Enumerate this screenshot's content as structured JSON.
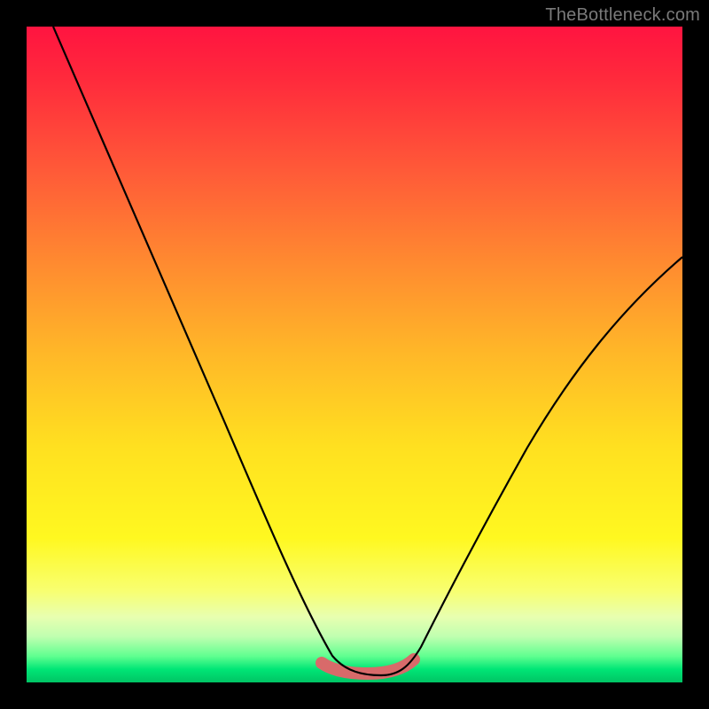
{
  "watermark": {
    "text": "TheBottleneck.com"
  },
  "chart_data": {
    "type": "line",
    "title": "",
    "xlabel": "",
    "ylabel": "",
    "xlim": [
      0,
      100
    ],
    "ylim": [
      0,
      100
    ],
    "grid": false,
    "legend": false,
    "gradient_stops": [
      {
        "pct": 0,
        "color": "#ff1440"
      },
      {
        "pct": 8,
        "color": "#ff2a3c"
      },
      {
        "pct": 22,
        "color": "#ff5a38"
      },
      {
        "pct": 36,
        "color": "#ff8a30"
      },
      {
        "pct": 50,
        "color": "#ffb828"
      },
      {
        "pct": 64,
        "color": "#ffe020"
      },
      {
        "pct": 78,
        "color": "#fff820"
      },
      {
        "pct": 86,
        "color": "#f8ff70"
      },
      {
        "pct": 90,
        "color": "#e8ffb0"
      },
      {
        "pct": 93,
        "color": "#c0ffb0"
      },
      {
        "pct": 96,
        "color": "#60ff90"
      },
      {
        "pct": 98,
        "color": "#00e676"
      },
      {
        "pct": 100,
        "color": "#00c464"
      }
    ],
    "series": [
      {
        "name": "bottleneck-curve",
        "x": [
          4,
          10,
          16,
          22,
          28,
          34,
          40,
          45,
          48,
          52,
          56,
          59,
          63,
          70,
          78,
          86,
          94,
          100
        ],
        "y": [
          100,
          88,
          76,
          64,
          52,
          40,
          28,
          16,
          8,
          1.5,
          1.5,
          6,
          14,
          26,
          38,
          49,
          58,
          65
        ]
      }
    ],
    "valley_marker": {
      "x_start": 45,
      "x_end": 59,
      "y": 2.5
    }
  }
}
